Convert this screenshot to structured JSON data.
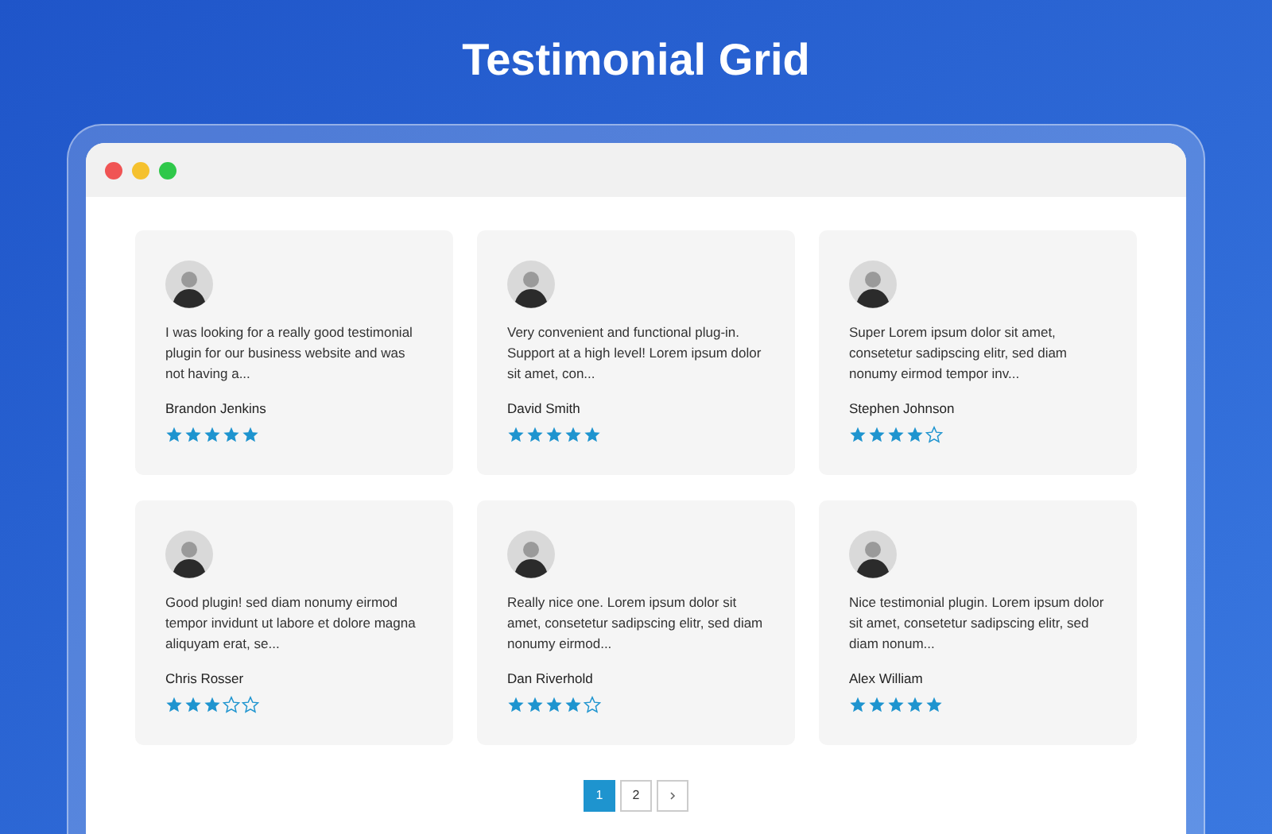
{
  "title": "Testimonial Grid",
  "testimonials": [
    {
      "text": "I was looking for a really good testimonial plugin for our business website and was not having a...",
      "name": "Brandon Jenkins",
      "stars": 5
    },
    {
      "text": "Very convenient and functional plug-in. Support at a high level! Lorem ipsum dolor sit amet, con...",
      "name": "David Smith",
      "stars": 5
    },
    {
      "text": "Super Lorem ipsum dolor sit amet, consetetur sadipscing elitr, sed diam nonumy eirmod tempor inv...",
      "name": "Stephen Johnson",
      "stars": 4
    },
    {
      "text": "Good plugin!  sed diam nonumy eirmod tempor invidunt ut labore et dolore magna aliquyam erat, se...",
      "name": "Chris Rosser",
      "stars": 3
    },
    {
      "text": "Really nice one. Lorem ipsum dolor sit amet, consetetur sadipscing elitr, sed diam nonumy eirmod...",
      "name": "Dan Riverhold",
      "stars": 4
    },
    {
      "text": "Nice testimonial plugin. Lorem ipsum dolor sit amet, consetetur sadipscing elitr, sed diam nonum...",
      "name": "Alex William",
      "stars": 5
    }
  ],
  "pagination": {
    "pages": [
      {
        "label": "1",
        "selected": true
      },
      {
        "label": "2",
        "selected": false
      }
    ]
  }
}
